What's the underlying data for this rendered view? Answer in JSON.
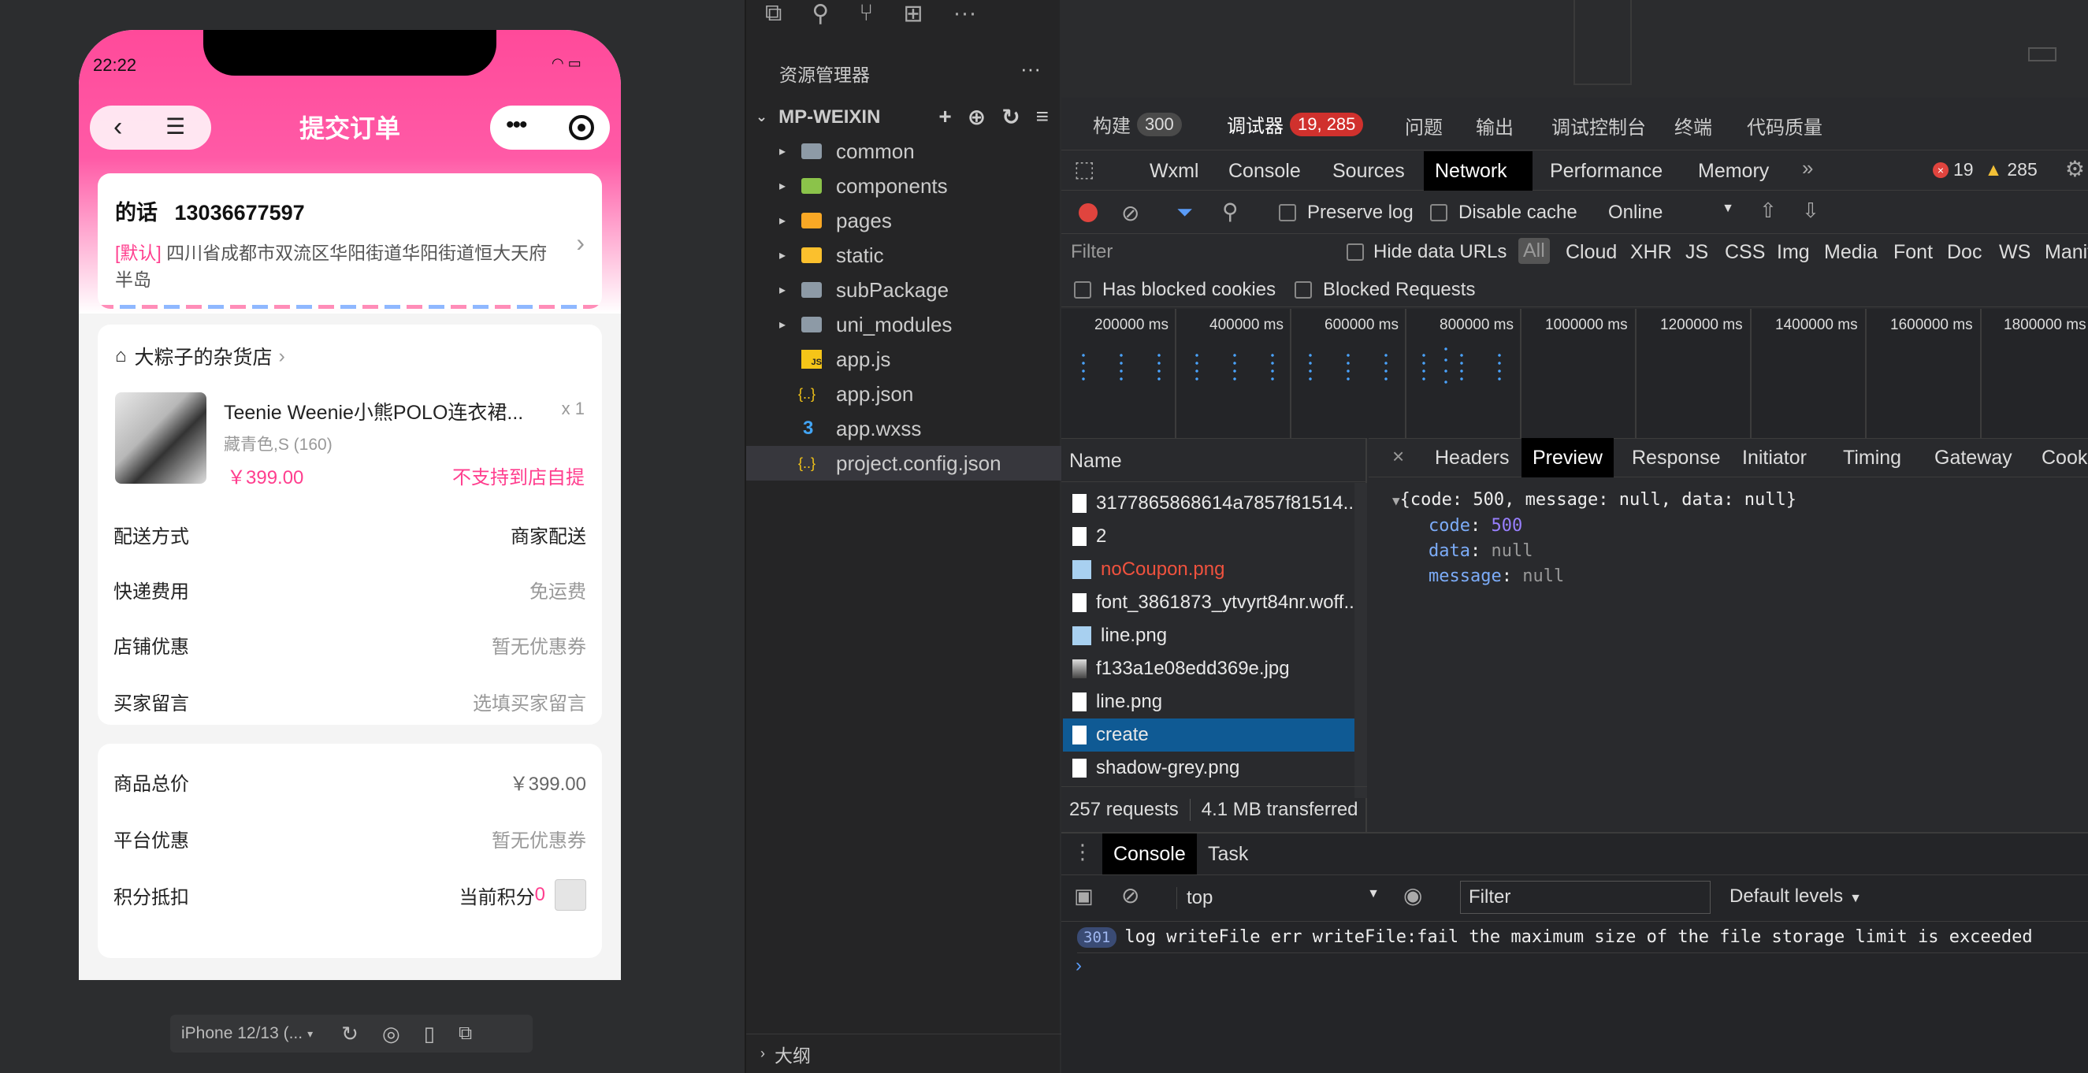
{
  "phone": {
    "time": "22:22",
    "title": "提交订单",
    "address": {
      "name": "的话",
      "phone": "13036677597",
      "tag": "[默认]",
      "line1": "四川省成都市双流区华阳街道华阳街道恒大天府",
      "line2": "半岛"
    },
    "store": {
      "name": "大粽子的杂货店"
    },
    "product": {
      "title": "Teenie Weenie小熊POLO连衣裙...",
      "qty": "x 1",
      "spec": "藏青色,S (160)",
      "price": "￥399.00",
      "pickup": "不支持到店自提"
    },
    "order_rows": [
      {
        "label": "配送方式",
        "value": "商家配送"
      },
      {
        "label": "快递费用",
        "value": "免运费"
      },
      {
        "label": "店铺优惠",
        "value": "暂无优惠券"
      },
      {
        "label": "买家留言",
        "value": "选填买家留言"
      }
    ],
    "summary_rows": [
      {
        "label": "商品总价",
        "value": "￥399.00"
      },
      {
        "label": "平台优惠",
        "value": "暂无优惠券"
      }
    ],
    "points": {
      "label": "积分抵扣",
      "text": "当前积分",
      "value": "0"
    }
  },
  "simulator_bar": {
    "device": "iPhone 12/13 (..."
  },
  "explorer": {
    "title": "资源管理器",
    "project": "MP-WEIXIN",
    "items": [
      {
        "label": "common",
        "kind": "folder",
        "color": "#8d9aa6"
      },
      {
        "label": "components",
        "kind": "folder",
        "color": "#8bc34a"
      },
      {
        "label": "pages",
        "kind": "folder",
        "color": "#f9a825"
      },
      {
        "label": "static",
        "kind": "folder",
        "color": "#fbc02d"
      },
      {
        "label": "subPackage",
        "kind": "folder",
        "color": "#8d9aa6"
      },
      {
        "label": "uni_modules",
        "kind": "folder",
        "color": "#8d9aa6"
      },
      {
        "label": "app.js",
        "kind": "js",
        "icon": "JS"
      },
      {
        "label": "app.json",
        "kind": "json",
        "icon": "{..}"
      },
      {
        "label": "app.wxss",
        "kind": "css",
        "icon": "3"
      },
      {
        "label": "project.config.json",
        "kind": "json",
        "icon": "{..}"
      }
    ],
    "outline": "大纲"
  },
  "devtools": {
    "top_tabs": [
      {
        "label": "构建",
        "badge": "300"
      },
      {
        "label": "调试器",
        "badge": "19, 285"
      },
      {
        "label": "问题"
      },
      {
        "label": "输出"
      },
      {
        "label": "调试控制台"
      },
      {
        "label": "终端"
      },
      {
        "label": "代码质量"
      }
    ],
    "panel_tabs": [
      "Wxml",
      "Console",
      "Sources",
      "Network",
      "Performance",
      "Memory"
    ],
    "errors": "19",
    "warnings": "285",
    "toolbar": {
      "preserve_log": "Preserve log",
      "disable_cache": "Disable cache",
      "throttle": "Online"
    },
    "filter": {
      "placeholder": "Filter",
      "hide_data_urls": "Hide data URLs",
      "types": [
        "All",
        "Cloud",
        "XHR",
        "JS",
        "CSS",
        "Img",
        "Media",
        "Font",
        "Doc",
        "WS",
        "Manif"
      ]
    },
    "blocked_cookies": "Has blocked cookies",
    "blocked_requests": "Blocked Requests",
    "timeline_ticks": [
      "200000 ms",
      "400000 ms",
      "600000 ms",
      "800000 ms",
      "1000000 ms",
      "1200000 ms",
      "1400000 ms",
      "1600000 ms",
      "1800000 ms"
    ],
    "name_header": "Name",
    "requests": [
      {
        "name": "3177865868614a7857f81514..",
        "type": "doc"
      },
      {
        "name": "2",
        "type": "doc"
      },
      {
        "name": "noCoupon.png",
        "type": "img",
        "error": true
      },
      {
        "name": "font_3861873_ytvyrt84nr.woff..",
        "type": "doc"
      },
      {
        "name": "line.png",
        "type": "img"
      },
      {
        "name": "f133a1e08edd369e.jpg",
        "type": "photo"
      },
      {
        "name": "line.png",
        "type": "doc"
      },
      {
        "name": "create",
        "type": "doc",
        "selected": true
      },
      {
        "name": "shadow-grey.png",
        "type": "doc"
      }
    ],
    "footer": {
      "requests": "257 requests",
      "transferred": "4.1 MB transferred"
    },
    "detail_tabs": [
      "Headers",
      "Preview",
      "Response",
      "Initiator",
      "Timing",
      "Gateway",
      "Cooki"
    ],
    "preview": {
      "summary": "{code: 500, message: null, data: null}",
      "fields": [
        {
          "key": "code",
          "value": "500"
        },
        {
          "key": "data",
          "value": "null"
        },
        {
          "key": "message",
          "value": "null"
        }
      ]
    },
    "drawer_tabs": [
      "Console",
      "Task"
    ],
    "console": {
      "context": "top",
      "filter": "Filter",
      "levels": "Default levels",
      "count": "301",
      "message": "log writeFile err writeFile:fail the maximum size of the file storage limit is exceeded"
    }
  }
}
